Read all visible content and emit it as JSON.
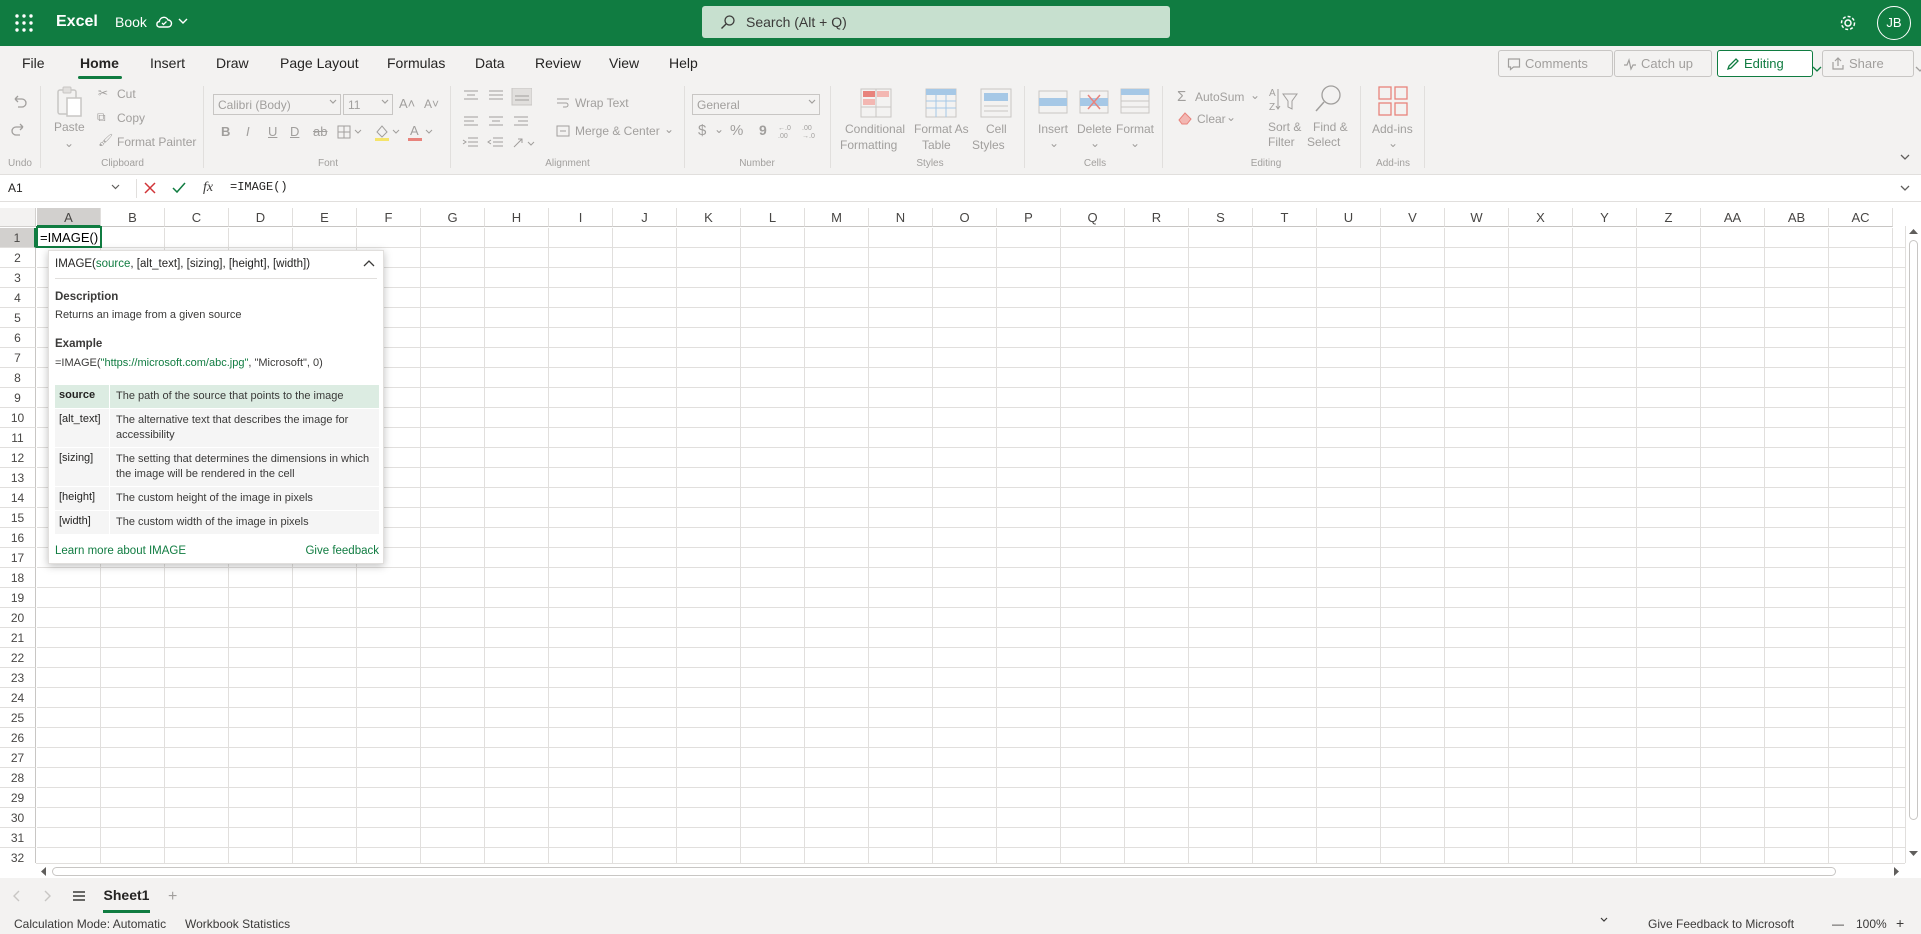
{
  "app": {
    "name": "Excel",
    "doc_name": "Book",
    "user_initials": "JB"
  },
  "search": {
    "placeholder": "Search (Alt + Q)"
  },
  "menu": {
    "tabs": [
      "File",
      "Home",
      "Insert",
      "Draw",
      "Page Layout",
      "Formulas",
      "Data",
      "Review",
      "View",
      "Help"
    ],
    "active": "Home",
    "comments": "Comments",
    "catch_up": "Catch up",
    "editing": "Editing",
    "share": "Share"
  },
  "ribbon": {
    "undo_group": "Undo",
    "clipboard": {
      "paste": "Paste",
      "cut": "Cut",
      "copy": "Copy",
      "format_painter": "Format Painter",
      "group": "Clipboard"
    },
    "font": {
      "name": "Calibri (Body)",
      "size": "11",
      "group": "Font",
      "bold": "B",
      "italic": "I",
      "underline": "U",
      "double_underline": "D",
      "strike": "ab"
    },
    "alignment": {
      "wrap": "Wrap Text",
      "merge": "Merge & Center",
      "group": "Alignment"
    },
    "number": {
      "format": "General",
      "currency": "$",
      "percent": "%",
      "comma": "9",
      "group": "Number"
    },
    "styles": {
      "conditional_1": "Conditional",
      "conditional_2": "Formatting",
      "table_1": "Format As",
      "table_2": "Table",
      "cell_1": "Cell",
      "cell_2": "Styles",
      "group": "Styles"
    },
    "cells": {
      "insert": "Insert",
      "delete": "Delete",
      "format": "Format",
      "group": "Cells"
    },
    "editing": {
      "autosum": "AutoSum",
      "clear": "Clear",
      "sort_1": "Sort &",
      "sort_2": "Filter",
      "find_1": "Find &",
      "find_2": "Select",
      "group": "Editing"
    },
    "addins": {
      "label": "Add-ins",
      "group": "Add-ins"
    }
  },
  "formula_bar": {
    "name_box": "A1",
    "fx": "fx",
    "formula": "=IMAGE()"
  },
  "grid": {
    "columns": [
      "A",
      "B",
      "C",
      "D",
      "E",
      "F",
      "G",
      "H",
      "I",
      "J",
      "K",
      "L",
      "M",
      "N",
      "O",
      "P",
      "Q",
      "R",
      "S",
      "T",
      "U",
      "V",
      "W",
      "X",
      "Y",
      "Z",
      "AA",
      "AB",
      "AC"
    ],
    "rows": [
      "1",
      "2",
      "3",
      "4",
      "5",
      "6",
      "7",
      "8",
      "9",
      "10",
      "11",
      "12",
      "13",
      "14",
      "15",
      "16",
      "17",
      "18",
      "19",
      "20",
      "21",
      "22",
      "23",
      "24",
      "25",
      "26",
      "27",
      "28",
      "29",
      "30",
      "31",
      "32"
    ],
    "active_cell": "A1",
    "a1_value": "=IMAGE()"
  },
  "tooltip": {
    "fn": "IMAGE(",
    "sig_arg1": "source",
    "sig_rest": ", [alt_text], [sizing], [height], [width])",
    "desc_head": "Description",
    "desc": "Returns an image from a given source",
    "example_head": "Example",
    "example_pre": "=IMAGE(",
    "example_str": "\"https://microsoft.com/abc.jpg\"",
    "example_post": ", \"Microsoft\", 0)",
    "params": [
      {
        "name": "source",
        "desc": "The path of the source that points to the image"
      },
      {
        "name": "[alt_text]",
        "desc": "The alternative text that describes the image for accessibility"
      },
      {
        "name": "[sizing]",
        "desc": "The setting that determines the dimensions in which the image will be rendered in the cell"
      },
      {
        "name": "[height]",
        "desc": "The custom height of the image in pixels"
      },
      {
        "name": "[width]",
        "desc": "The custom width of the image in pixels"
      }
    ],
    "learn_more": "Learn more about IMAGE",
    "feedback": "Give feedback"
  },
  "sheets": {
    "active": "Sheet1"
  },
  "status": {
    "calc_mode": "Calculation Mode: Automatic",
    "stats": "Workbook Statistics",
    "feedback": "Give Feedback to Microsoft",
    "zoom": "100%",
    "zoom_out": "—",
    "zoom_in": "+"
  }
}
